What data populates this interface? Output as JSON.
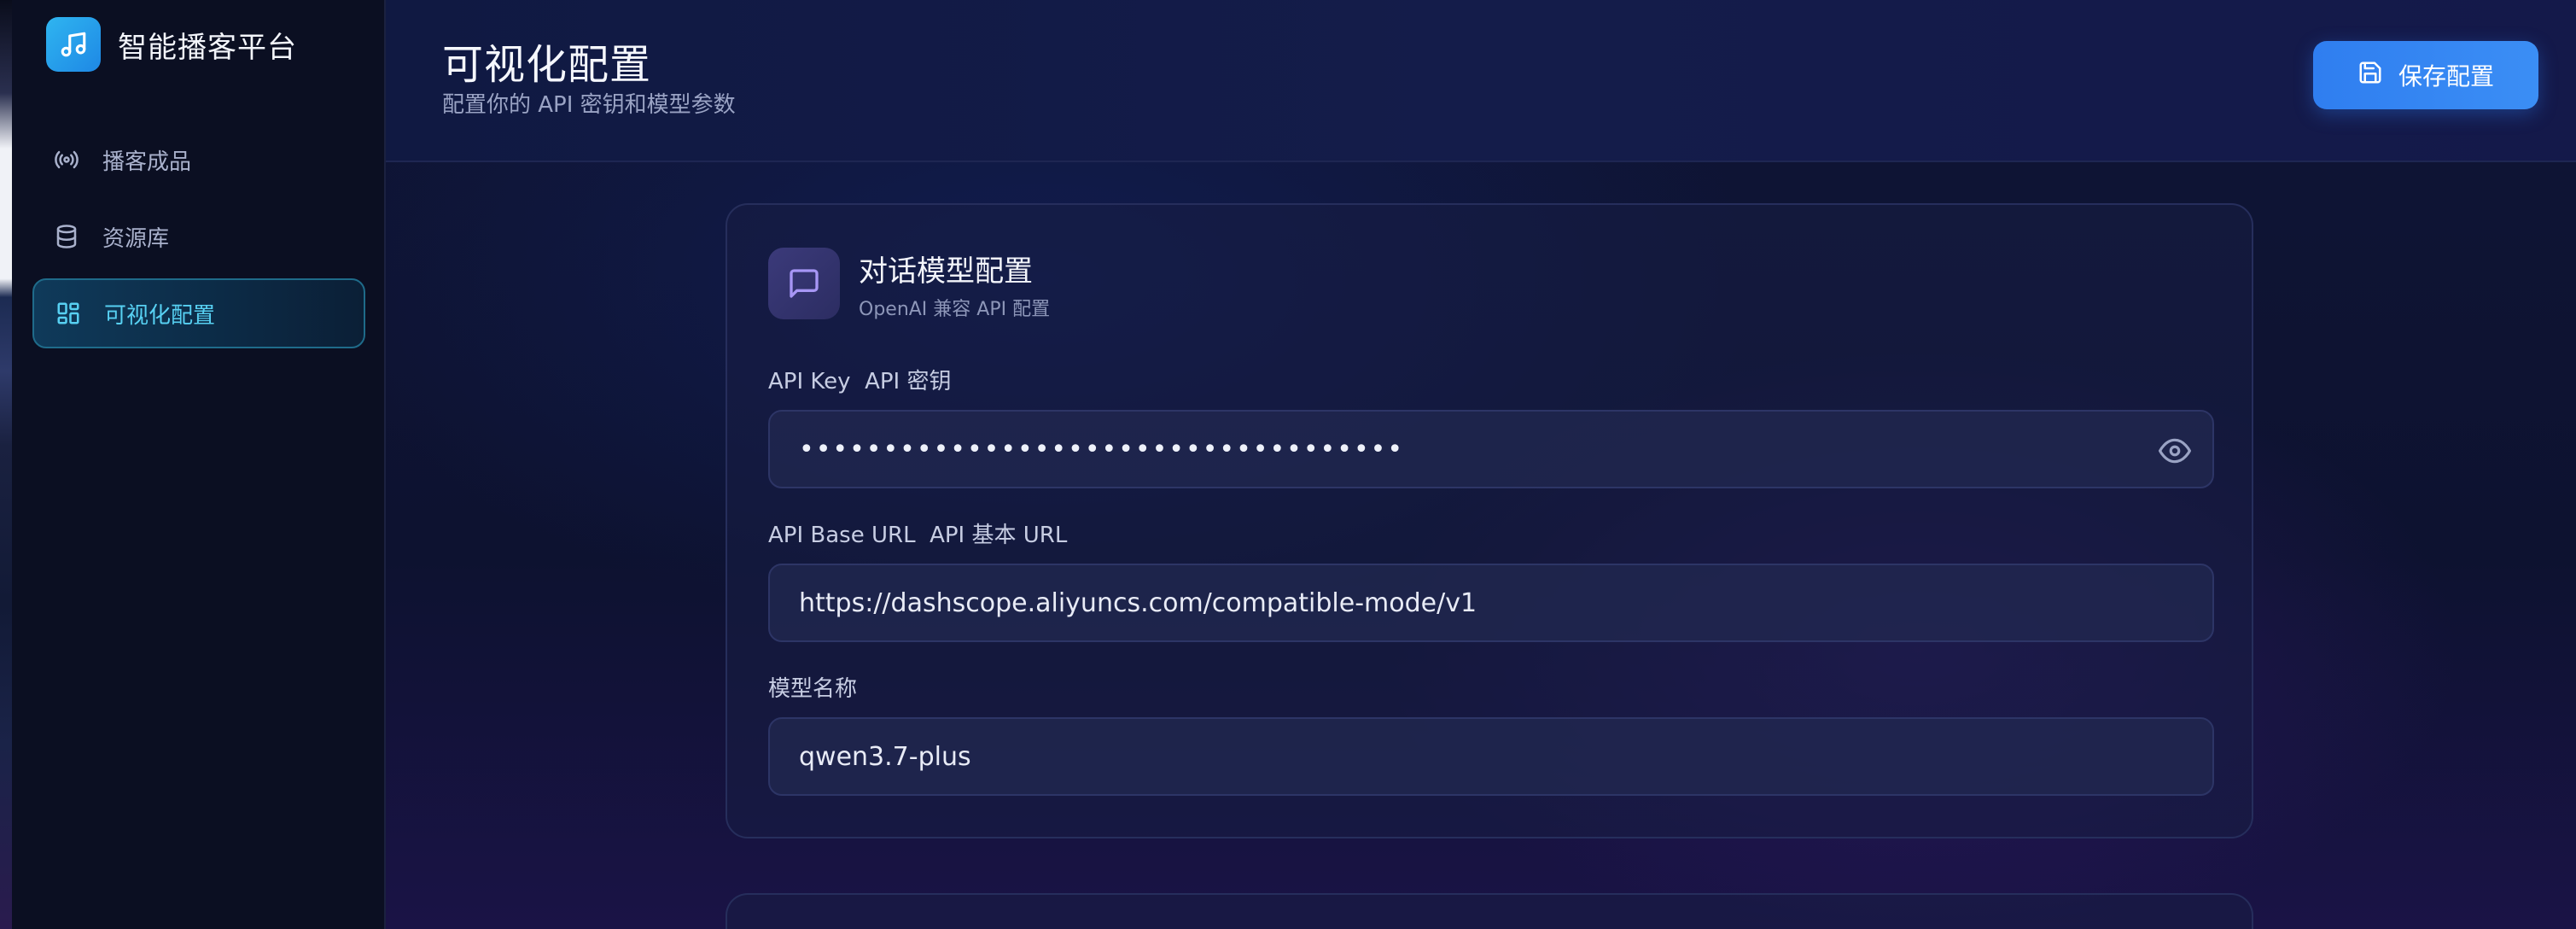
{
  "sidebar": {
    "brand_title": "智能播客平台",
    "items": [
      {
        "label": "播客成品",
        "icon": "broadcast-icon",
        "active": false
      },
      {
        "label": "资源库",
        "icon": "database-icon",
        "active": false
      },
      {
        "label": "可视化配置",
        "icon": "layout-grid-icon",
        "active": true
      }
    ]
  },
  "header": {
    "title": "可视化配置",
    "subtitle": "配置你的 API 密钥和模型参数",
    "save_label": "保存配置"
  },
  "card": {
    "title": "对话模型配置",
    "subtitle": "OpenAI 兼容 API 配置",
    "fields": [
      {
        "label": "API Key  API 密钥",
        "value": "••••••••••••••••••••••••••••••••••••",
        "type": "password"
      },
      {
        "label": "API Base URL  API 基本 URL",
        "value": "https://dashscope.aliyuncs.com/compatible-mode/v1",
        "type": "text"
      },
      {
        "label": "模型名称",
        "value": "qwen3.7-plus",
        "type": "text"
      }
    ]
  },
  "colors": {
    "accent": "#3b8ef5",
    "active_nav": "#57d0f2",
    "background": "#0f1536"
  }
}
